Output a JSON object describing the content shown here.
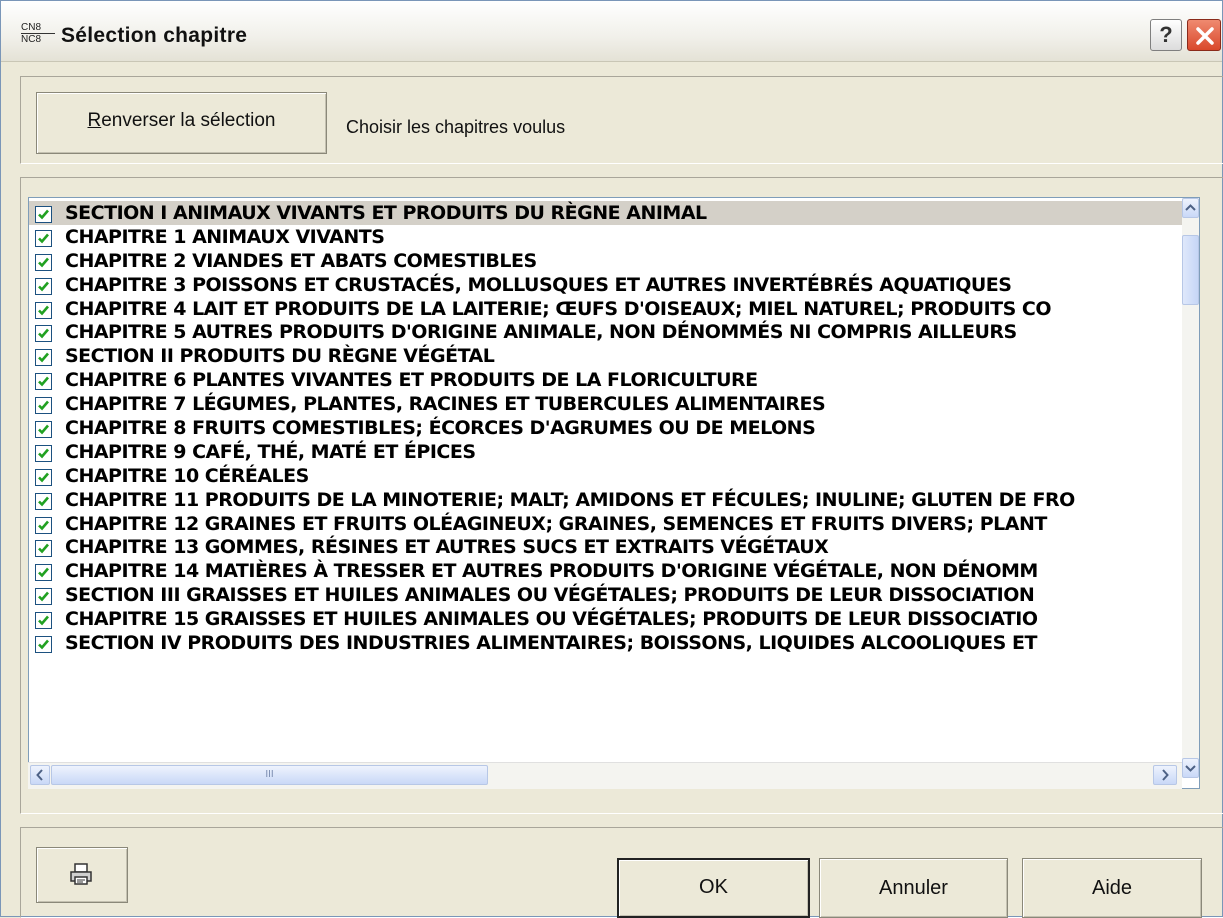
{
  "window": {
    "title": "Sélection chapitre",
    "icon_top": "CN8",
    "icon_bottom": "NC8",
    "help_label": "?"
  },
  "top": {
    "invert_button_label_first": "R",
    "invert_button_label_rest": "enverser la sélection",
    "hint": "Choisir les chapitres voulus"
  },
  "list": {
    "items": [
      {
        "label": "SECTION I ANIMAUX VIVANTS ET PRODUITS DU RÈGNE ANIMAL",
        "checked": true,
        "selected": true
      },
      {
        "label": "CHAPITRE 1 ANIMAUX VIVANTS",
        "checked": true
      },
      {
        "label": "CHAPITRE 2 VIANDES ET ABATS COMESTIBLES",
        "checked": true
      },
      {
        "label": "CHAPITRE 3 POISSONS ET CRUSTACÉS, MOLLUSQUES ET AUTRES INVERTÉBRÉS AQUATIQUES",
        "checked": true
      },
      {
        "label": "CHAPITRE 4 LAIT ET PRODUITS DE LA LAITERIE; ŒUFS D'OISEAUX; MIEL NATUREL; PRODUITS CO",
        "checked": true
      },
      {
        "label": "CHAPITRE 5 AUTRES PRODUITS D'ORIGINE ANIMALE, NON DÉNOMMÉS NI COMPRIS AILLEURS",
        "checked": true
      },
      {
        "label": "SECTION II PRODUITS DU RÈGNE VÉGÉTAL",
        "checked": true
      },
      {
        "label": "CHAPITRE 6 PLANTES VIVANTES ET PRODUITS DE LA FLORICULTURE",
        "checked": true
      },
      {
        "label": "CHAPITRE 7 LÉGUMES, PLANTES, RACINES ET TUBERCULES ALIMENTAIRES",
        "checked": true
      },
      {
        "label": "CHAPITRE 8 FRUITS COMESTIBLES; ÉCORCES D'AGRUMES OU DE MELONS",
        "checked": true
      },
      {
        "label": "CHAPITRE 9 CAFÉ, THÉ, MATÉ ET ÉPICES",
        "checked": true
      },
      {
        "label": "CHAPITRE 10 CÉRÉALES",
        "checked": true
      },
      {
        "label": "CHAPITRE 11 PRODUITS DE LA MINOTERIE; MALT; AMIDONS ET FÉCULES; INULINE; GLUTEN DE FRO",
        "checked": true
      },
      {
        "label": "CHAPITRE 12 GRAINES ET FRUITS OLÉAGINEUX; GRAINES, SEMENCES ET FRUITS DIVERS; PLANT",
        "checked": true
      },
      {
        "label": "CHAPITRE 13 GOMMES, RÉSINES ET AUTRES SUCS ET EXTRAITS VÉGÉTAUX",
        "checked": true
      },
      {
        "label": "CHAPITRE 14 MATIÈRES À TRESSER ET AUTRES PRODUITS D'ORIGINE VÉGÉTALE, NON DÉNOMM",
        "checked": true
      },
      {
        "label": "SECTION III GRAISSES ET HUILES ANIMALES OU VÉGÉTALES; PRODUITS DE LEUR DISSOCIATION",
        "checked": true
      },
      {
        "label": "CHAPITRE 15 GRAISSES ET HUILES ANIMALES OU VÉGÉTALES; PRODUITS DE LEUR DISSOCIATIO",
        "checked": true
      },
      {
        "label": "SECTION IV PRODUITS DES INDUSTRIES ALIMENTAIRES; BOISSONS, LIQUIDES ALCOOLIQUES ET",
        "checked": true
      }
    ],
    "hscroll_grip": "III"
  },
  "footer": {
    "ok_label": "OK",
    "cancel_label": "Annuler",
    "help_label": "Aide",
    "print_icon": "printer-icon"
  },
  "colors": {
    "face": "#ece9d8",
    "selected_row": "#d4d0c8",
    "close_button": "#d9482b"
  }
}
